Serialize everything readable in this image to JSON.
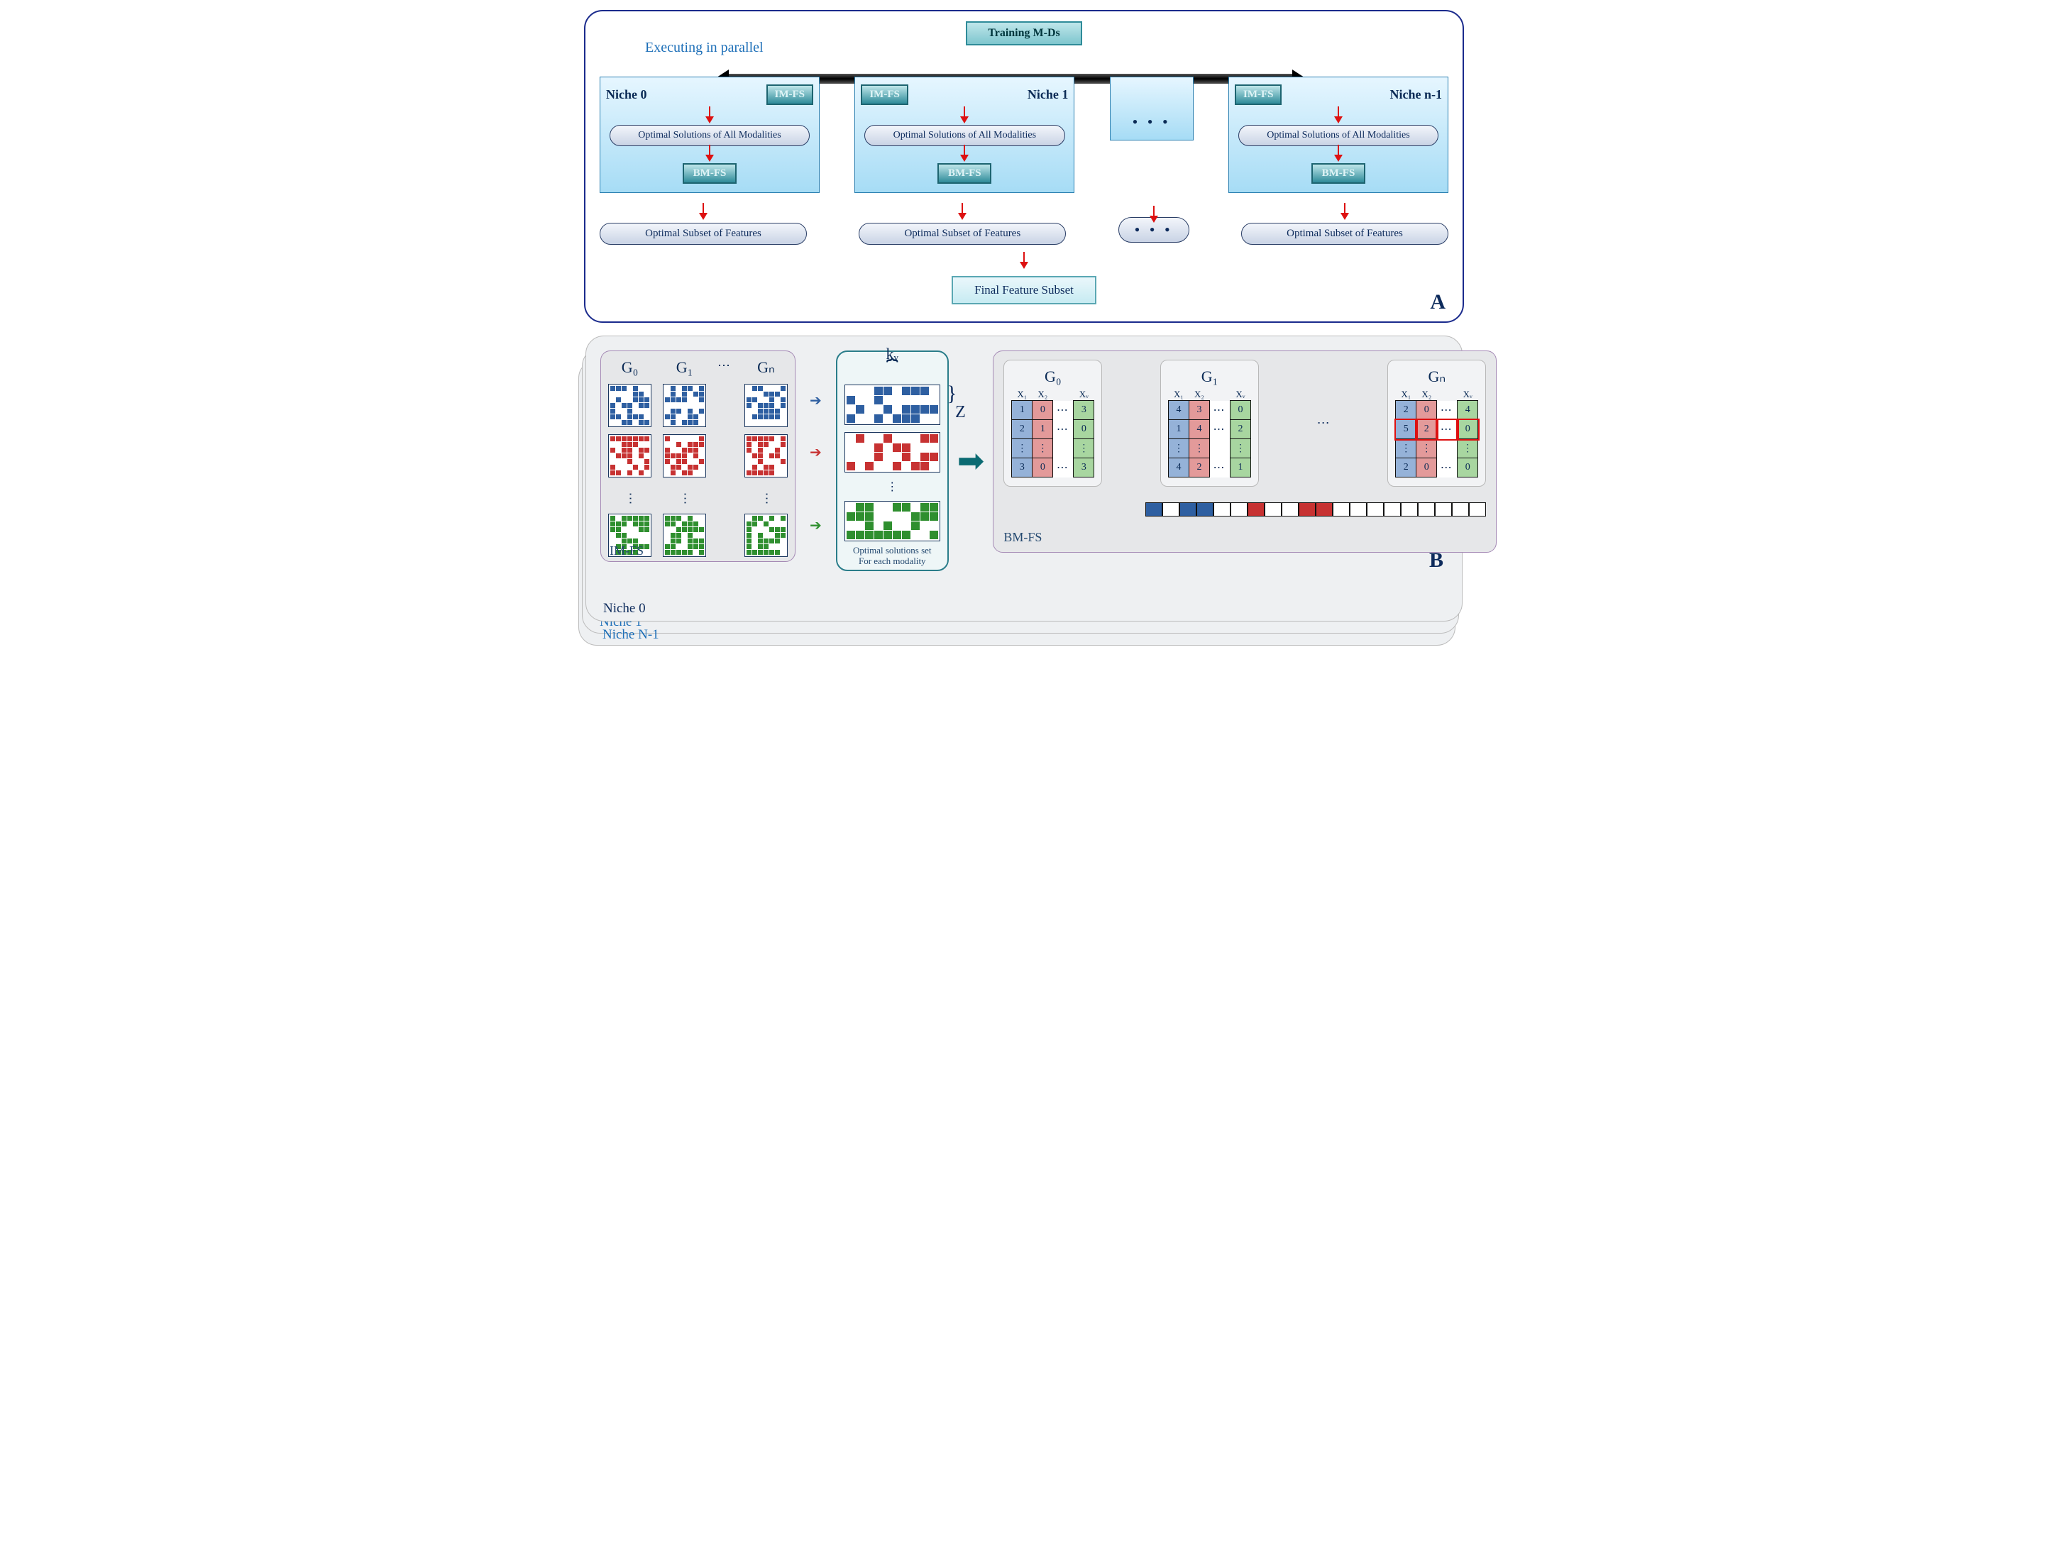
{
  "panelA": {
    "tag": "A",
    "parallel_label": "Executing in parallel",
    "training_box": "Training M-Ds",
    "niches": [
      {
        "title": "Niche 0",
        "imfs": "IM-FS",
        "opt": "Optimal Solutions of All Modalities",
        "bmfs": "BM-FS",
        "out": "Optimal Subset of Features"
      },
      {
        "title": "Niche 1",
        "imfs": "IM-FS",
        "opt": "Optimal Solutions of All Modalities",
        "bmfs": "BM-FS",
        "out": "Optimal Subset of Features"
      },
      {
        "title": "…",
        "ellipsis": true
      },
      {
        "title": "Niche n-1",
        "imfs": "IM-FS",
        "opt": "Optimal Solutions of All Modalities",
        "bmfs": "BM-FS",
        "out": "Optimal Subset of Features"
      }
    ],
    "final_box": "Final Feature Subset"
  },
  "panelB": {
    "tag": "B",
    "imfs_label": "IM-FS",
    "bmfs_label": "BM-FS",
    "g_headers": [
      "G₀",
      "G₁",
      "Gₙ"
    ],
    "kv_label": "kᵥ",
    "z_label": "Z",
    "opt_caption_l1": "Optimal solutions set",
    "opt_caption_l2": "For each modality",
    "table_headers": [
      "X₁",
      "X₂",
      "Xᵥ"
    ],
    "tables": [
      {
        "g": "G₀",
        "rows": [
          [
            "1",
            "0",
            "3"
          ],
          [
            "2",
            "1",
            "0"
          ],
          [
            "⋮",
            "⋮",
            "⋮"
          ],
          [
            "3",
            "0",
            "3"
          ]
        ]
      },
      {
        "g": "G₁",
        "rows": [
          [
            "4",
            "3",
            "0"
          ],
          [
            "1",
            "4",
            "2"
          ],
          [
            "⋮",
            "⋮",
            "⋮"
          ],
          [
            "4",
            "2",
            "1"
          ]
        ]
      },
      {
        "g": "Gₙ",
        "rows": [
          [
            "2",
            "0",
            "4"
          ],
          [
            "5",
            "2",
            "0"
          ],
          [
            "⋮",
            "⋮",
            "⋮"
          ],
          [
            "2",
            "0",
            "0"
          ]
        ],
        "highlight_row": 1
      }
    ],
    "niche_labels": [
      "Niche 0",
      "Niche 1",
      "Niche N-1"
    ]
  }
}
